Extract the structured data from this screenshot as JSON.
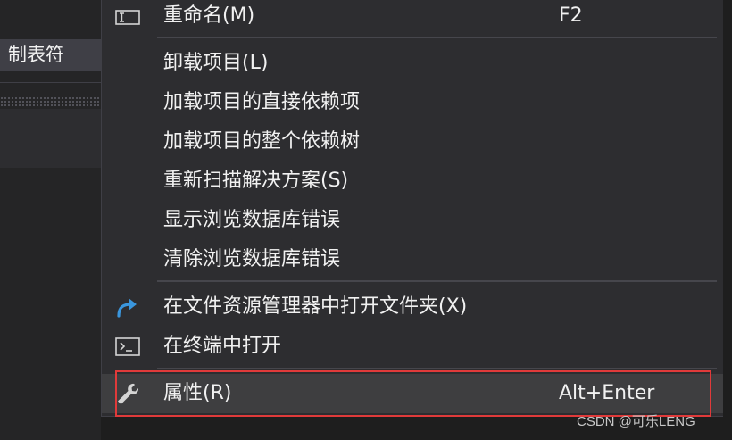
{
  "left_panel": {
    "tab_label": "制表符"
  },
  "menu": {
    "rename": {
      "label": "重命名(M)",
      "shortcut": "F2",
      "icon": "rename-icon"
    },
    "unload_project": {
      "label": "卸载项目(L)"
    },
    "load_direct_deps": {
      "label": "加载项目的直接依赖项"
    },
    "load_all_deps": {
      "label": "加载项目的整个依赖树"
    },
    "rescan_solution": {
      "label": "重新扫描解决方案(S)"
    },
    "show_browse_db_errors": {
      "label": "显示浏览数据库错误"
    },
    "clear_browse_db_errors": {
      "label": "清除浏览数据库错误"
    },
    "open_in_explorer": {
      "label": "在文件资源管理器中打开文件夹(X)",
      "icon": "redo-arrow-icon"
    },
    "open_in_terminal": {
      "label": "在终端中打开",
      "icon": "terminal-icon"
    },
    "properties": {
      "label": "属性(R)",
      "shortcut": "Alt+Enter",
      "icon": "wrench-icon"
    }
  },
  "colors": {
    "menu_background": "#2d2d30",
    "hover_background": "#3e3e40",
    "highlight_border": "#e03a3a",
    "icon_blue": "#3a96dd"
  },
  "watermark": "CSDN @可乐LENG"
}
